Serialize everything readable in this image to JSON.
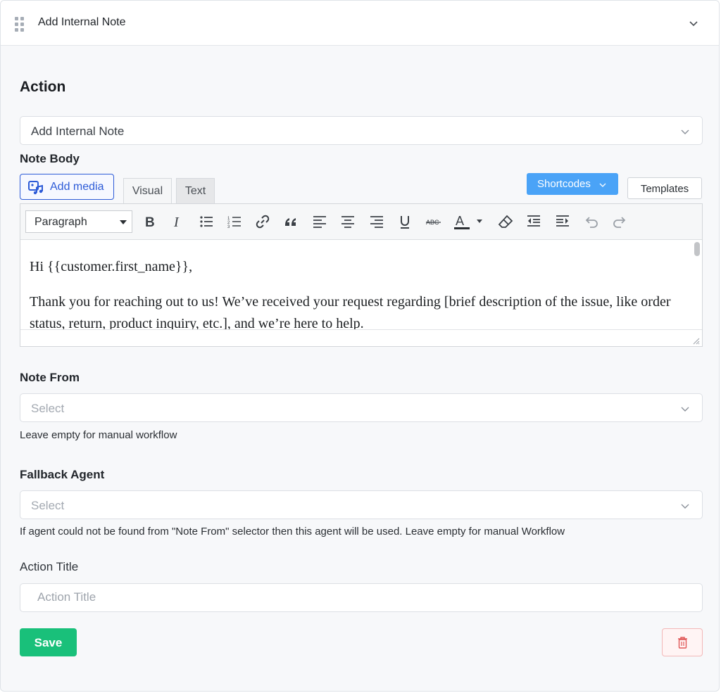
{
  "header": {
    "title": "Add Internal Note"
  },
  "action_section": {
    "title": "Action",
    "selected_action": "Add Internal Note"
  },
  "note_body": {
    "label": "Note Body",
    "add_media_label": "Add media",
    "tabs": {
      "visual": "Visual",
      "text": "Text"
    },
    "shortcodes_label": "Shortcodes",
    "templates_label": "Templates",
    "toolbar": {
      "format_value": "Paragraph",
      "buttons": [
        "bold-icon",
        "italic-icon",
        "bullet-list-icon",
        "numbered-list-icon",
        "link-icon",
        "blockquote-icon",
        "align-left-icon",
        "align-center-icon",
        "align-right-icon",
        "underline-icon",
        "strikethrough-icon",
        "text-color-icon",
        "clear-formatting-icon",
        "outdent-icon",
        "indent-icon",
        "undo-icon",
        "redo-icon"
      ]
    },
    "content": {
      "line1": "Hi {{customer.first_name}},",
      "line2": "Thank you for reaching out to us! We’ve received your request regarding [brief description of the issue, like order status, return, product inquiry, etc.], and we’re here to help."
    }
  },
  "note_from": {
    "label": "Note From",
    "placeholder": "Select",
    "help": "Leave empty for manual workflow"
  },
  "fallback_agent": {
    "label": "Fallback Agent",
    "placeholder": "Select",
    "help": "If agent could not be found from \"Note From\" selector then this agent will be used. Leave empty for manual Workflow"
  },
  "action_title": {
    "label": "Action Title",
    "placeholder": "Action Title"
  },
  "buttons": {
    "save": "Save"
  },
  "colors": {
    "primary_blue": "#2d5bd7",
    "shortcodes_blue": "#4aa3f7",
    "save_green": "#19c07a",
    "danger_red": "#e05656"
  }
}
